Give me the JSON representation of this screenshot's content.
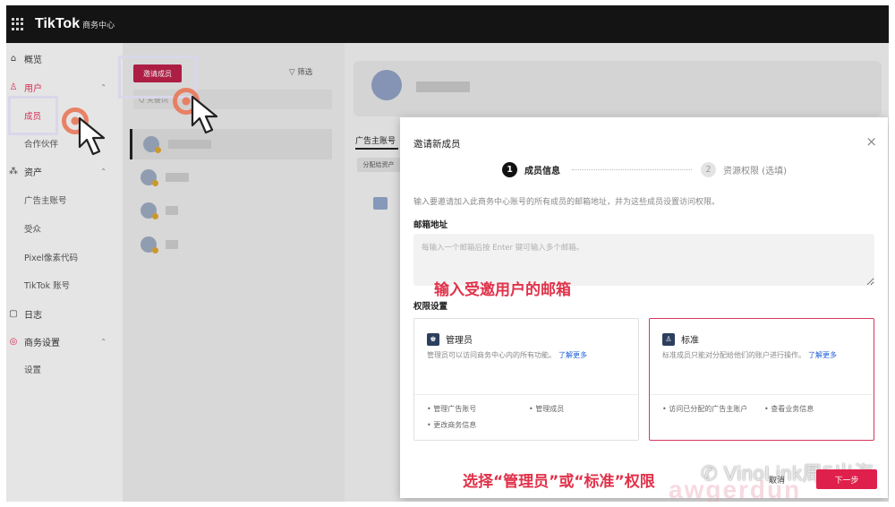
{
  "app": {
    "brand": "TikTok",
    "brand_sub": "商务中心"
  },
  "sidebar": {
    "items": [
      {
        "label": "概览",
        "icon": "home-icon"
      },
      {
        "label": "用户",
        "icon": "user-icon"
      },
      {
        "label": "成员"
      },
      {
        "label": "合作伙伴"
      },
      {
        "label": "资产",
        "icon": "assets-icon"
      },
      {
        "label": "广告主账号"
      },
      {
        "label": "受众"
      },
      {
        "label": "Pixel像素代码"
      },
      {
        "label": "TikTok 账号"
      },
      {
        "label": "日志",
        "icon": "log-icon"
      },
      {
        "label": "商务设置",
        "icon": "settings-icon"
      },
      {
        "label": "设置"
      }
    ]
  },
  "members": {
    "invite_label": "邀请成员",
    "filter_label": "筛选",
    "search_placeholder": "Q 关键词"
  },
  "detail": {
    "tab_label": "广告主账号",
    "chip_label": "分配给资产"
  },
  "modal": {
    "title": "邀请新成员",
    "steps": [
      {
        "num": "1",
        "label": "成员信息"
      },
      {
        "num": "2",
        "label": "资源权限 (选填)"
      }
    ],
    "intro": "输入要邀请加入此商务中心账号的所有成员的邮箱地址，并为这些成员设置访问权限。",
    "email_label": "邮箱地址",
    "email_placeholder": "每输入一个邮箱后按 Enter 键可输入多个邮箱。",
    "permission_label": "权限设置",
    "roles": {
      "admin": {
        "name": "管理员",
        "desc": "管理员可以访问商务中心内的所有功能。",
        "more": "了解更多",
        "features": [
          "管理广告账号",
          "管理成员",
          "更改商务信息"
        ]
      },
      "standard": {
        "name": "标准",
        "desc": "标准成员只能对分配给他们的账户进行操作。",
        "more": "了解更多",
        "features": [
          "访问已分配的广告主账户",
          "查看业务信息"
        ]
      }
    },
    "cancel_label": "取消",
    "next_label": "下一步"
  },
  "annotations": {
    "email_hint": "输入受邀用户的邮箱",
    "role_hint": "选择“管理员”或“标准”权限",
    "watermark": "VinoLink周5出海"
  }
}
